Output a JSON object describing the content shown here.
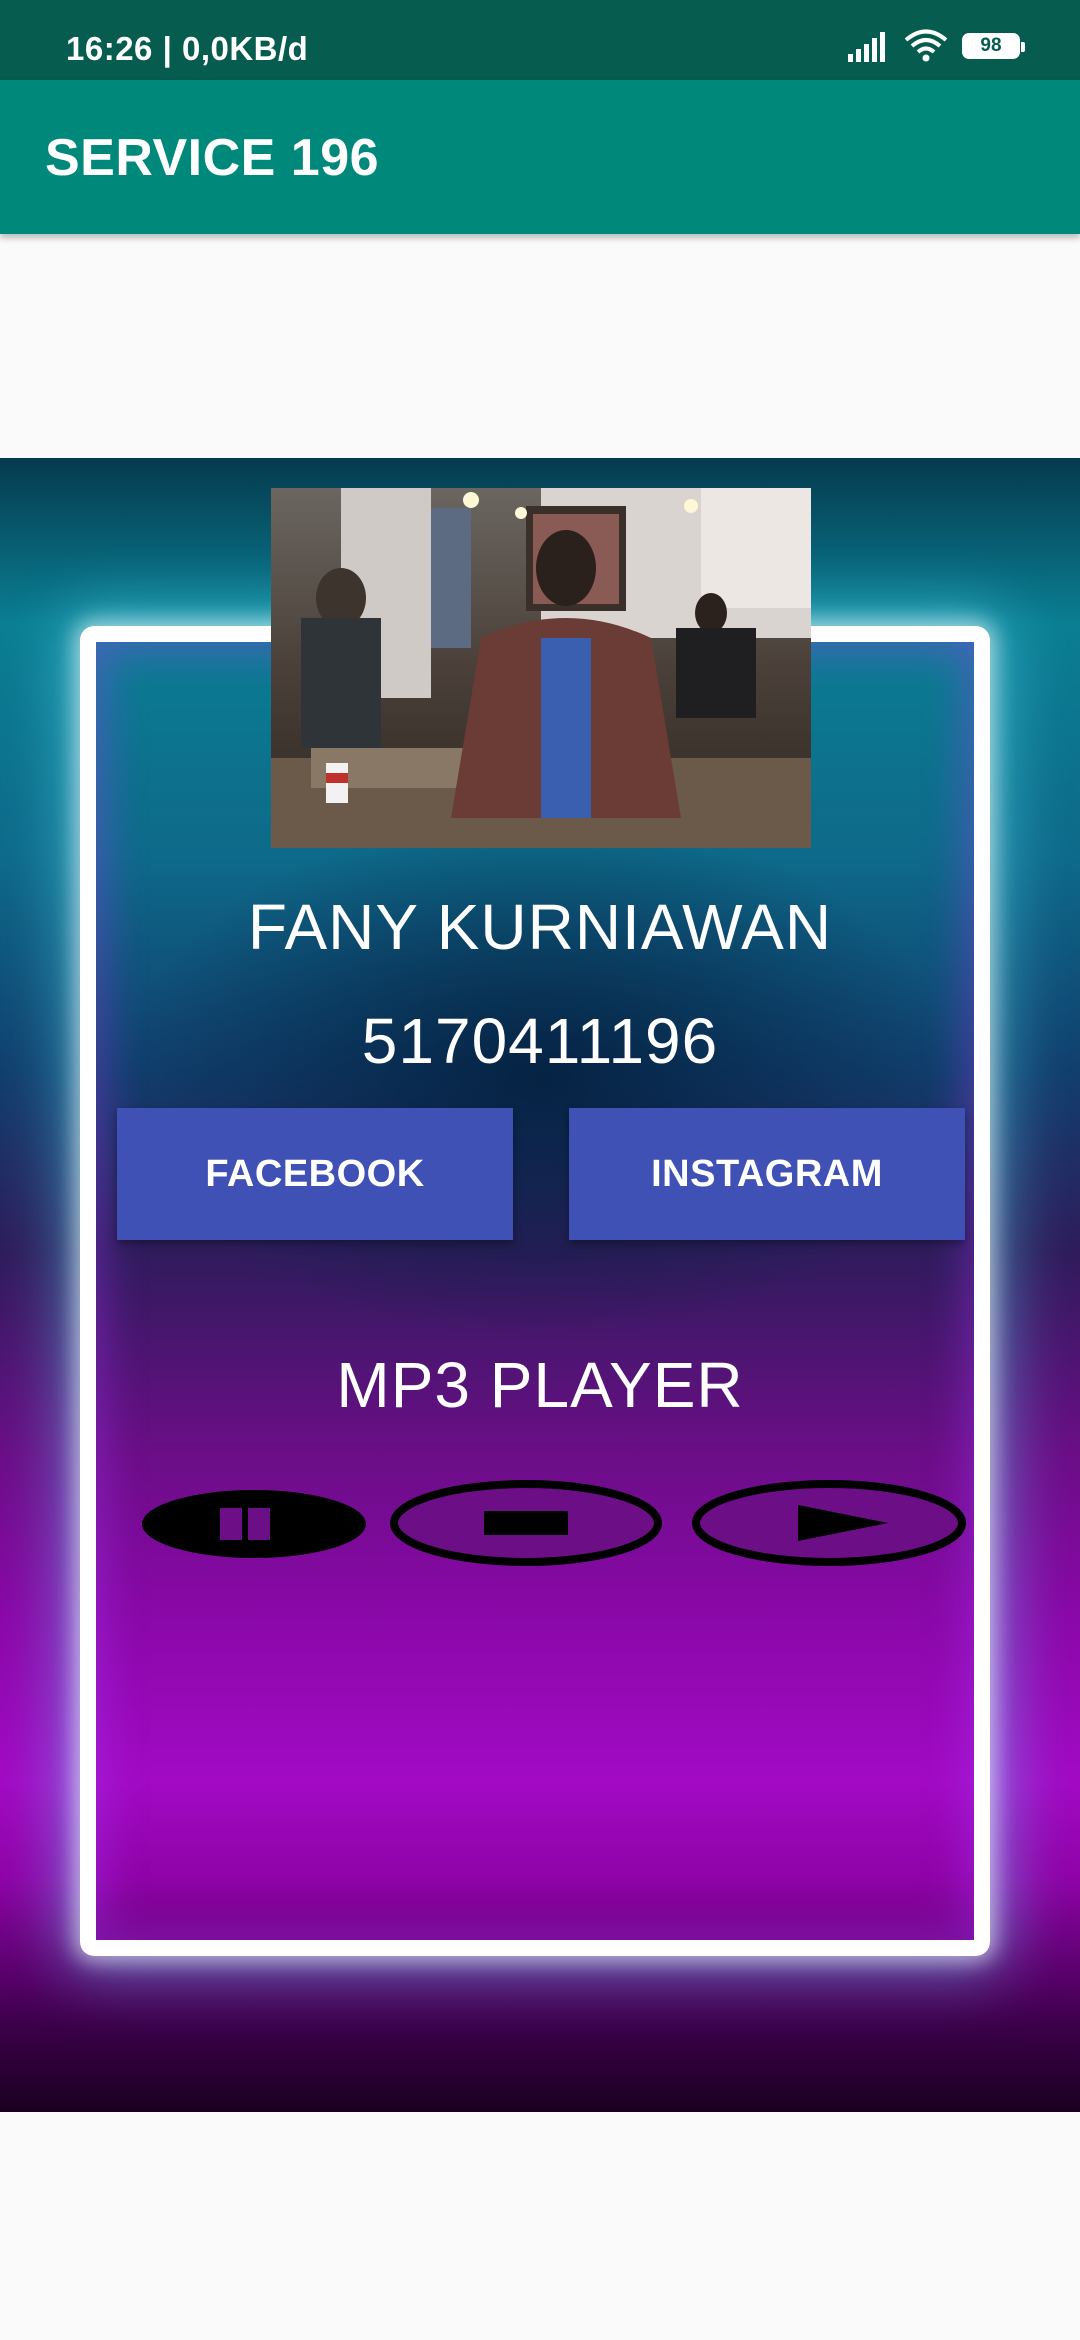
{
  "status_bar": {
    "time_and_speed": "16:26 | 0,0KB/d",
    "battery_level": "98"
  },
  "app_bar": {
    "title": "SERVICE 196"
  },
  "profile": {
    "name": "FANY KURNIAWAN",
    "number": "5170411196"
  },
  "social_buttons": {
    "facebook_label": "FACEBOOK",
    "instagram_label": "INSTAGRAM"
  },
  "player": {
    "title": "MP3 PLAYER",
    "controls": [
      "pause-icon",
      "stop-icon",
      "play-icon"
    ]
  },
  "colors": {
    "status_bar": "#065c4f",
    "app_bar": "#00897b",
    "button": "#3f51b5",
    "neon_frame": "#ffffff"
  }
}
